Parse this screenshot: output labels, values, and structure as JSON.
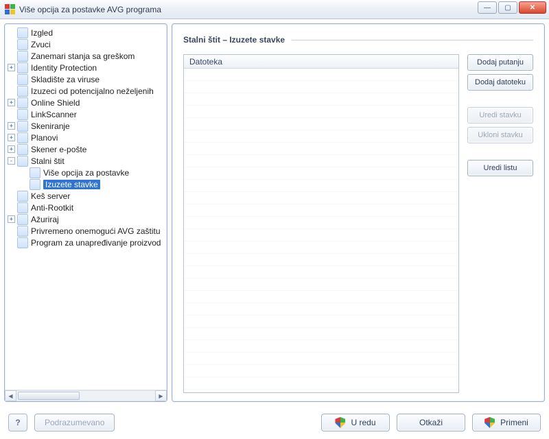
{
  "window": {
    "title": "Više opcija za postavke AVG programa"
  },
  "tree": {
    "items": [
      {
        "label": "Izgled",
        "indent": 1,
        "expander": ""
      },
      {
        "label": "Zvuci",
        "indent": 1,
        "expander": ""
      },
      {
        "label": "Zanemari stanja sa greškom",
        "indent": 1,
        "expander": ""
      },
      {
        "label": "Identity Protection",
        "indent": 1,
        "expander": "+"
      },
      {
        "label": "Skladište za viruse",
        "indent": 1,
        "expander": ""
      },
      {
        "label": "Izuzeci od potencijalno neželjenih",
        "indent": 1,
        "expander": ""
      },
      {
        "label": "Online Shield",
        "indent": 1,
        "expander": "+"
      },
      {
        "label": "LinkScanner",
        "indent": 1,
        "expander": ""
      },
      {
        "label": "Skeniranje",
        "indent": 1,
        "expander": "+",
        "iconVariant": "schedule"
      },
      {
        "label": "Planovi",
        "indent": 1,
        "expander": "+",
        "iconVariant": "schedule"
      },
      {
        "label": "Skener e-pošte",
        "indent": 1,
        "expander": "+"
      },
      {
        "label": "Stalni štit",
        "indent": 1,
        "expander": "-"
      },
      {
        "label": "Više opcija za postavke",
        "indent": 2,
        "expander": ""
      },
      {
        "label": "Izuzete stavke",
        "indent": 2,
        "expander": "",
        "selected": true
      },
      {
        "label": "Keš server",
        "indent": 1,
        "expander": ""
      },
      {
        "label": "Anti-Rootkit",
        "indent": 1,
        "expander": ""
      },
      {
        "label": "Ažuriraj",
        "indent": 1,
        "expander": "+"
      },
      {
        "label": "Privremeno onemogući AVG zaštitu",
        "indent": 1,
        "expander": ""
      },
      {
        "label": "Program za unapređivanje proizvod",
        "indent": 1,
        "expander": ""
      }
    ]
  },
  "main": {
    "heading": "Stalni štit – Izuzete stavke",
    "columnHeader": "Datoteka",
    "buttons": {
      "addPath": "Dodaj putanju",
      "addFile": "Dodaj datoteku",
      "editItem": "Uredi stavku",
      "removeItem": "Ukloni stavku",
      "editList": "Uredi listu"
    }
  },
  "footer": {
    "help": "?",
    "defaults": "Podrazumevano",
    "ok": "U redu",
    "cancel": "Otkaži",
    "apply": "Primeni"
  }
}
